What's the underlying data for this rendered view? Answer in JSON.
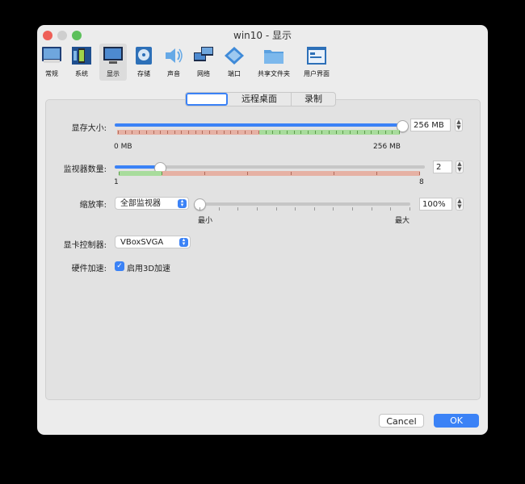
{
  "window": {
    "title": "win10 - 显示"
  },
  "toolbar": {
    "items": [
      {
        "label": "常规",
        "icon": "monitor-icon"
      },
      {
        "label": "系统",
        "icon": "chip-icon"
      },
      {
        "label": "显示",
        "icon": "display-icon",
        "active": true
      },
      {
        "label": "存储",
        "icon": "disk-icon"
      },
      {
        "label": "声音",
        "icon": "speaker-icon"
      },
      {
        "label": "网络",
        "icon": "network-icon"
      },
      {
        "label": "端口",
        "icon": "port-icon"
      },
      {
        "label": "共享文件夹",
        "icon": "folder-icon"
      },
      {
        "label": "用户界面",
        "icon": "window-icon"
      }
    ]
  },
  "tabs": [
    {
      "label": ""
    },
    {
      "label": "远程桌面"
    },
    {
      "label": "录制"
    }
  ],
  "video_memory": {
    "label": "显存大小:",
    "value": "256 MB",
    "min_label": "0 MB",
    "max_label": "256 MB",
    "level": 1.0
  },
  "monitor_count": {
    "label": "监视器数量:",
    "value": "2",
    "min_label": "1",
    "max_label": "8",
    "level": 0.142
  },
  "scale": {
    "label": "缩放率:",
    "select_value": "全部监视器",
    "value": "100%",
    "min_label": "最小",
    "max_label": "最大",
    "level": 0.0
  },
  "graphics_controller": {
    "label": "显卡控制器:",
    "value": "VBoxSVGA"
  },
  "acceleration": {
    "label": "硬件加速:",
    "checkbox_label": "启用3D加速",
    "checked": true
  },
  "buttons": {
    "cancel": "Cancel",
    "ok": "OK"
  },
  "colors": {
    "accent": "#3b82f6",
    "range_bad": "#e6b1a4",
    "range_good": "#a8dc9c"
  }
}
